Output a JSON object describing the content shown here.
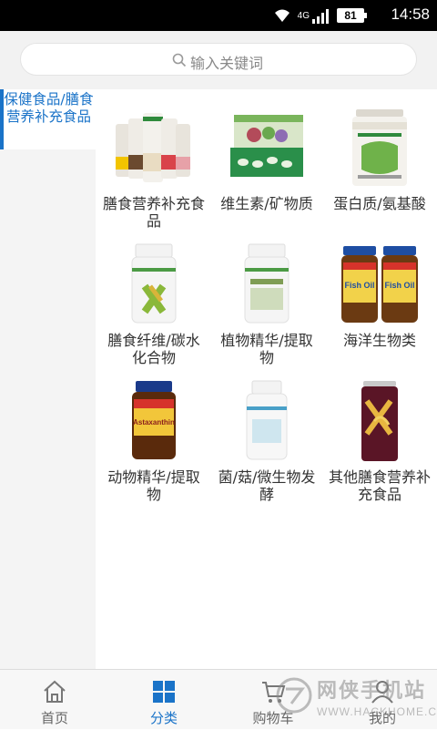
{
  "status_bar": {
    "time": "14:58",
    "battery": "81",
    "network": "4G"
  },
  "search": {
    "placeholder": "输入关键词"
  },
  "sidebar": {
    "items": [
      {
        "label": "保健食品/膳食营养补充食品"
      }
    ]
  },
  "categories": [
    {
      "label": "膳食营养补充食品",
      "image": "protein-shake-cans-image"
    },
    {
      "label": "维生素/矿物质",
      "image": "vitamin-box-image"
    },
    {
      "label": "蛋白质/氨基酸",
      "image": "protein-powder-jar-image"
    },
    {
      "label": "膳食纤维/碳水化合物",
      "image": "fiber-bottle-image"
    },
    {
      "label": "植物精华/提取物",
      "image": "herbal-bottle-image"
    },
    {
      "label": "海洋生物类",
      "image": "fish-oil-bottles-image"
    },
    {
      "label": "动物精华/提取物",
      "image": "astaxanthin-bottle-image"
    },
    {
      "label": "菌/菇/微生物发酵",
      "image": "probiotic-bottle-image"
    },
    {
      "label": "其他膳食营养补充食品",
      "image": "energy-drink-can-image"
    }
  ],
  "fish_oil_label": "Fish Oil",
  "astaxanthin_label": "Astaxanthin",
  "tabs": [
    {
      "label": "首页",
      "icon": "home-icon"
    },
    {
      "label": "分类",
      "icon": "grid-icon",
      "active": true
    },
    {
      "label": "购物车",
      "icon": "cart-icon"
    },
    {
      "label": "我的",
      "icon": "user-icon"
    }
  ],
  "watermark": {
    "title": "网侠手机站",
    "url": "WWW.HACKHOME.COM"
  },
  "colors": {
    "accent": "#1a73c8",
    "sidebar_bg": "#f4f4f4",
    "tabbar_bg": "#f7f7f7"
  }
}
